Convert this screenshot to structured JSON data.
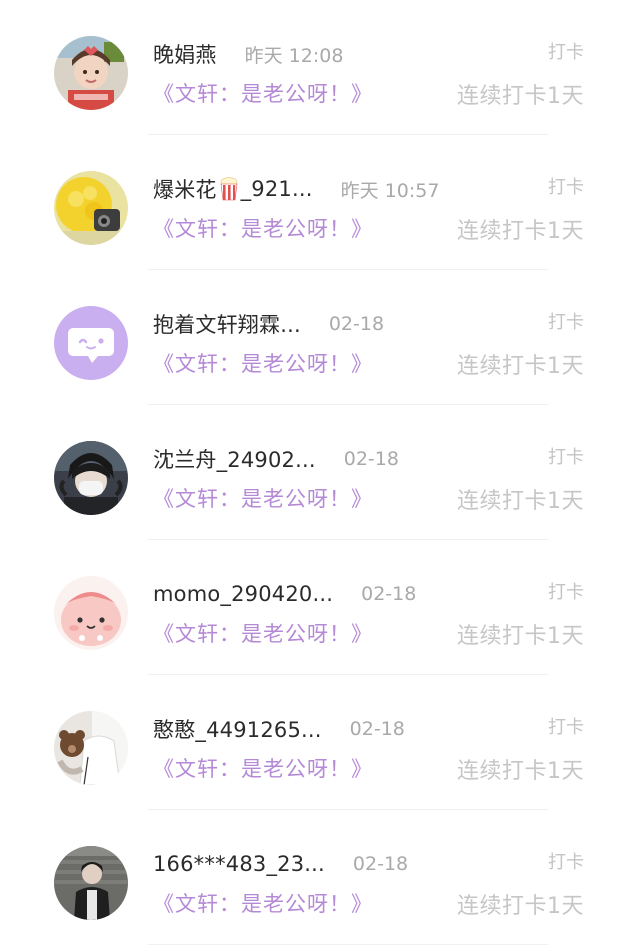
{
  "items": [
    {
      "name": "晚娟燕",
      "emoji": "",
      "time": "昨天 12:08",
      "quote": "《文轩：是老公呀！》",
      "action": "打卡",
      "streak": "连续打卡1天",
      "avatar": "avatar-child-photo"
    },
    {
      "name": "爆米花",
      "emoji": "popcorn-icon",
      "name_suffix": "_921...",
      "time": "昨天 10:57",
      "quote": "《文轩：是老公呀！》",
      "action": "打卡",
      "streak": "连续打卡1天",
      "avatar": "avatar-yellow-flower"
    },
    {
      "name": "抱着文轩翔霖...",
      "emoji": "",
      "time": "02-18",
      "quote": "《文轩：是老公呀！》",
      "action": "打卡",
      "streak": "连续打卡1天",
      "avatar": "avatar-default-chat"
    },
    {
      "name": "沈兰舟_24902...",
      "emoji": "",
      "time": "02-18",
      "quote": "《文轩：是老公呀！》",
      "action": "打卡",
      "streak": "连续打卡1天",
      "avatar": "avatar-masked-person"
    },
    {
      "name": "momo_290420...",
      "emoji": "",
      "time": "02-18",
      "quote": "《文轩：是老公呀！》",
      "action": "打卡",
      "streak": "连续打卡1天",
      "avatar": "avatar-pink-cartoon"
    },
    {
      "name": "憨憨_4491265...",
      "emoji": "",
      "time": "02-18",
      "quote": "《文轩：是老公呀！》",
      "action": "打卡",
      "streak": "连续打卡1天",
      "avatar": "avatar-person-with-bear"
    },
    {
      "name": "166***483_23...",
      "emoji": "",
      "time": "02-18",
      "quote": "《文轩：是老公呀！》",
      "action": "打卡",
      "streak": "连续打卡1天",
      "avatar": "avatar-person-dark"
    }
  ],
  "colors": {
    "quote": "#b48ad6",
    "muted": "#c6c6c6",
    "time": "#a9a9a9",
    "default_avatar": "#c9aef0"
  }
}
